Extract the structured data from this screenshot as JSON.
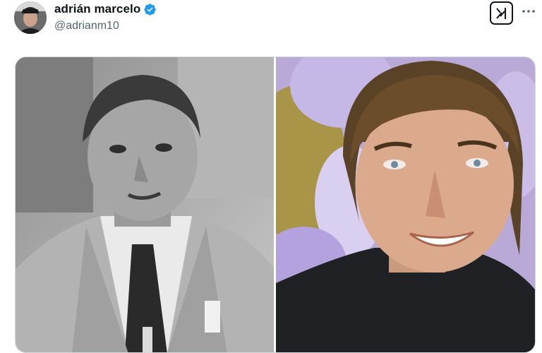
{
  "post": {
    "author": {
      "display_name": "adrián marcelo",
      "handle": "@adrianm10",
      "verified": true,
      "avatar_icon": "profile-avatar"
    },
    "actions": {
      "grok_icon": "grok-icon",
      "more_icon": "more-horizontal-icon"
    },
    "media": {
      "images": [
        {
          "description_icon": "photo-black-and-white-portrait"
        },
        {
          "description_icon": "photo-color-portrait"
        }
      ]
    }
  },
  "colors": {
    "text_primary": "#0f1419",
    "text_secondary": "#536471",
    "verified_blue": "#1d9bf0"
  }
}
